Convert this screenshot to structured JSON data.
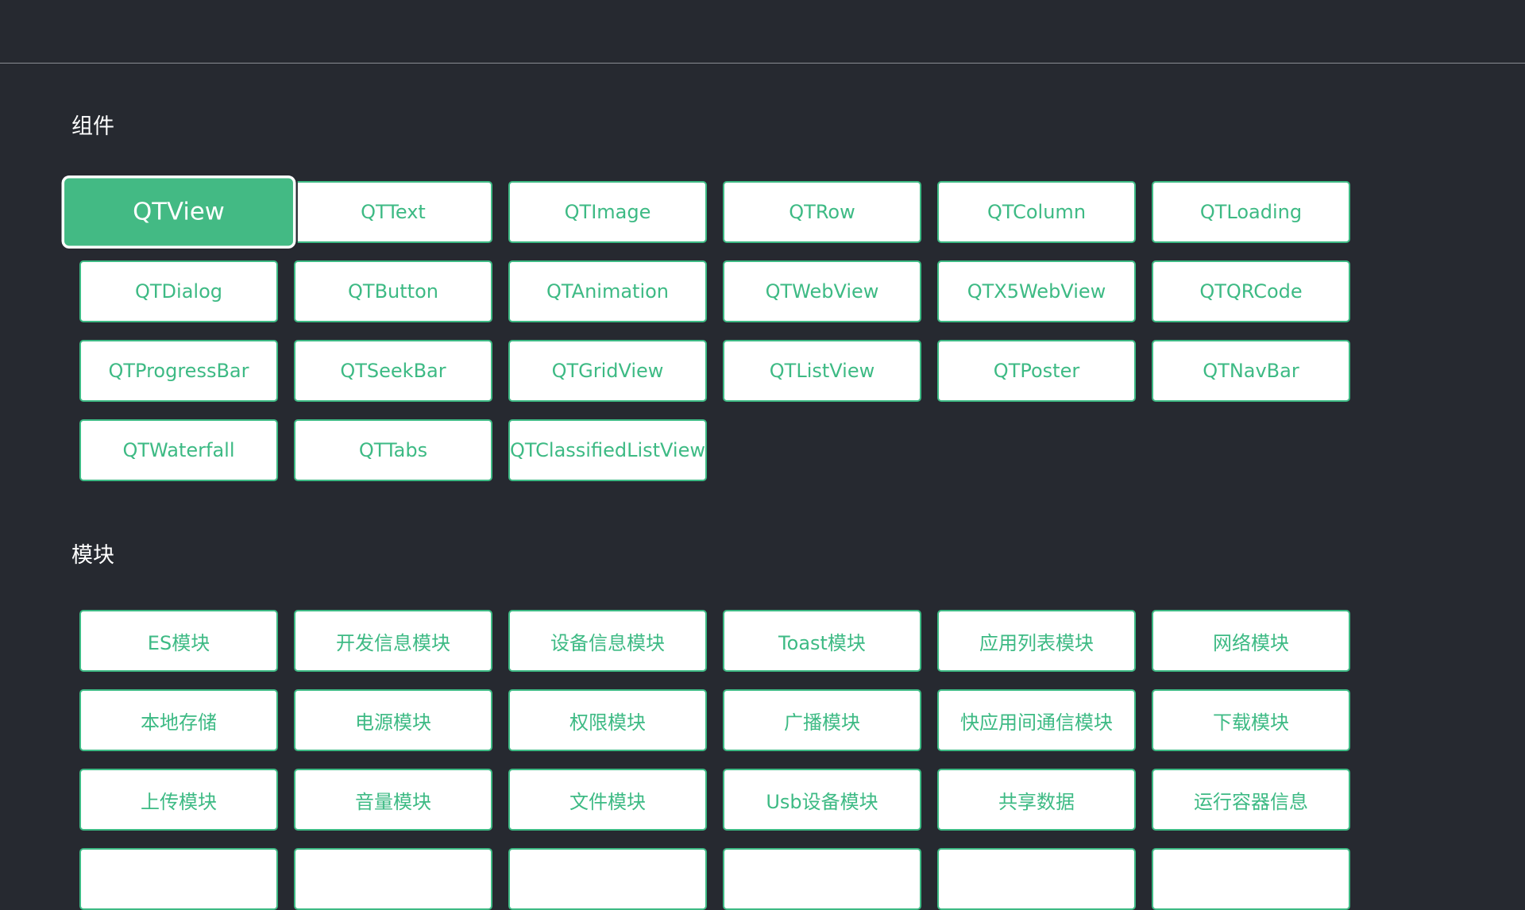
{
  "sections": {
    "components": {
      "title": "组件",
      "items": [
        "QTView",
        "QTText",
        "QTImage",
        "QTRow",
        "QTColumn",
        "QTLoading",
        "QTDialog",
        "QTButton",
        "QTAnimation",
        "QTWebView",
        "QTX5WebView",
        "QTQRCode",
        "QTProgressBar",
        "QTSeekBar",
        "QTGridView",
        "QTListView",
        "QTPoster",
        "QTNavBar",
        "QTWaterfall",
        "QTTabs",
        "QTClassifiedListView"
      ],
      "focused_item": "QTView"
    },
    "modules": {
      "title": "模块",
      "items": [
        "ES模块",
        "开发信息模块",
        "设备信息模块",
        "Toast模块",
        "应用列表模块",
        "网络模块",
        "本地存储",
        "电源模块",
        "权限模块",
        "广播模块",
        "快应用间通信模块",
        "下载模块",
        "上传模块",
        "音量模块",
        "文件模块",
        "Usb设备模块",
        "共享数据",
        "运行容器信息"
      ]
    }
  },
  "colors": {
    "background": "#262930",
    "accent": "#3dba84",
    "button_bg": "#ffffff",
    "focused_bg": "#43ba84"
  }
}
